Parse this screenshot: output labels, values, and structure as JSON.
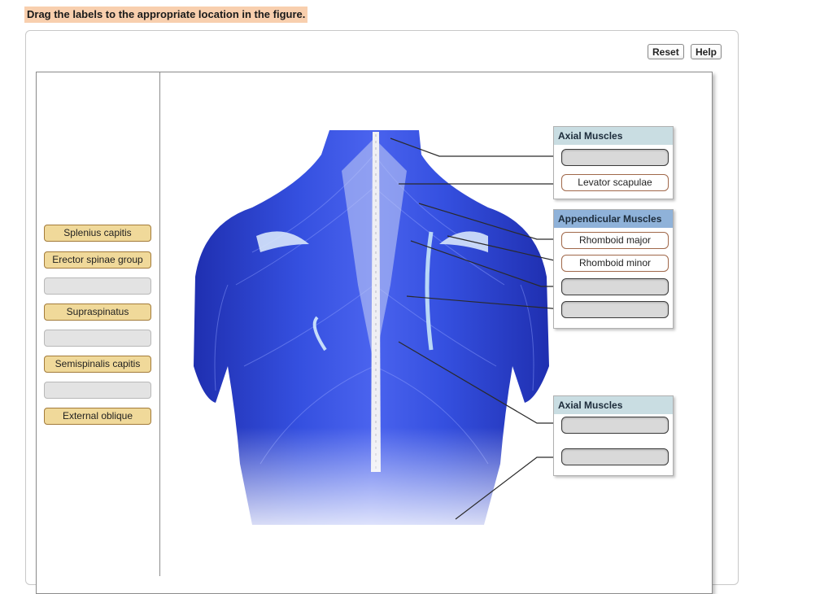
{
  "instruction": "Drag the labels to the appropriate location in the figure.",
  "toolbar": {
    "reset_label": "Reset",
    "help_label": "Help"
  },
  "label_bank": [
    {
      "text": "Splenius capitis",
      "state": "filled"
    },
    {
      "text": "Erector spinae group",
      "state": "filled"
    },
    {
      "text": "",
      "state": "empty"
    },
    {
      "text": "Supraspinatus",
      "state": "filled"
    },
    {
      "text": "",
      "state": "empty"
    },
    {
      "text": "Semispinalis capitis",
      "state": "filled"
    },
    {
      "text": "",
      "state": "empty"
    },
    {
      "text": "External oblique",
      "state": "filled"
    }
  ],
  "groups": [
    {
      "title": "Axial Muscles",
      "style": "teal",
      "targets": [
        {
          "text": "",
          "state": "empty"
        },
        {
          "text": "Levator scapulae",
          "state": "filled"
        }
      ]
    },
    {
      "title": "Appendicular Muscles",
      "style": "blue",
      "targets": [
        {
          "text": "Rhomboid major",
          "state": "filled"
        },
        {
          "text": "Rhomboid minor",
          "state": "filled"
        },
        {
          "text": "",
          "state": "empty"
        },
        {
          "text": "",
          "state": "empty"
        }
      ]
    },
    {
      "title": "Axial Muscles",
      "style": "teal",
      "targets": [
        {
          "text": "",
          "state": "empty"
        },
        {
          "text": "",
          "state": "empty"
        }
      ]
    }
  ],
  "colors": {
    "instruction_highlight": "#f8cfae",
    "label_fill": "#f0d99a",
    "label_border": "#a37b3a",
    "muscle_blue": "#2f46d8",
    "header_teal": "#c9dde2",
    "header_blue": "#8fb2d9"
  }
}
